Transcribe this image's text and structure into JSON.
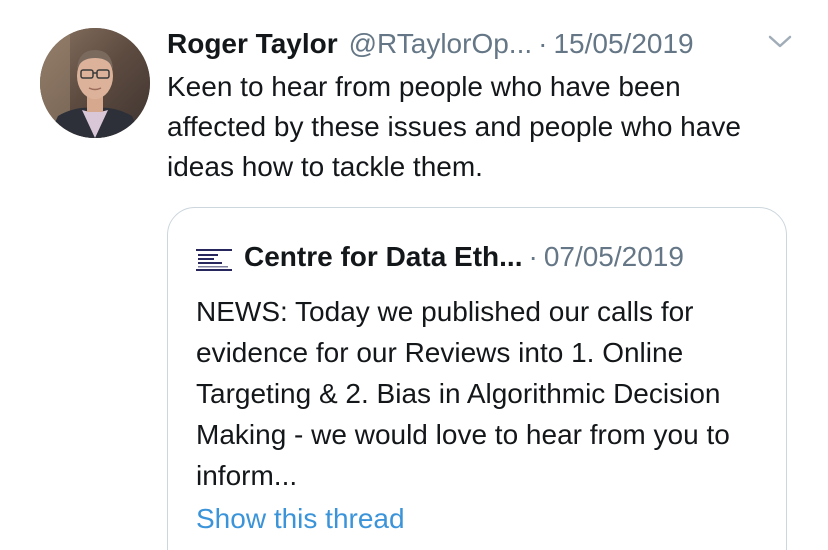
{
  "tweet": {
    "author_name": "Roger Taylor",
    "handle": "@RTaylorOp...",
    "separator": "·",
    "date": "15/05/2019",
    "text": "Keen to hear from people who have been affected by these issues and people who have ideas how to tackle them.",
    "menu_icon": "chevron-down-icon",
    "avatar_icon": "person-photo"
  },
  "quote": {
    "author_name": "Centre for Data Eth...",
    "separator": "·",
    "date": "07/05/2019",
    "logo_text": "Centre for Data Ethics and Innovation",
    "text": "NEWS: Today we published our calls for evidence for our Reviews into 1. Online Targeting & 2. Bias in Algorithmic Decision Making - we would love to hear from you to inform...",
    "show_thread_label": "Show this thread"
  },
  "colors": {
    "text": "#14171a",
    "secondary": "#657786",
    "link": "#3b94d9",
    "border": "#ccd6dd",
    "logo_navy": "#27265d"
  }
}
